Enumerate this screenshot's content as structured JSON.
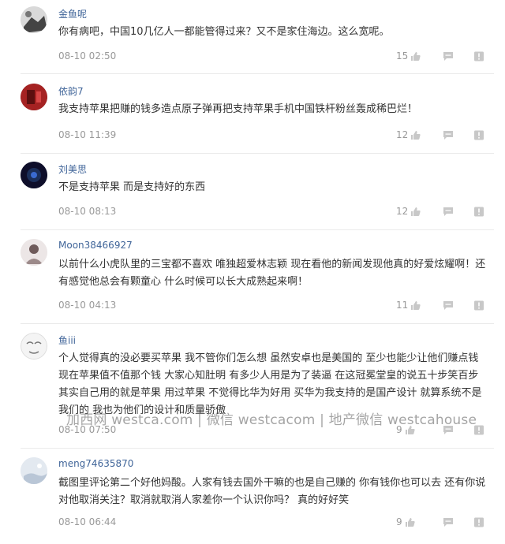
{
  "comments": [
    {
      "user": "金鱼呢",
      "text": "你有病吧，中国10几亿人一都能管得过来？又不是家住海边。这么宽呢。",
      "time": "08-10 02:50",
      "likes": "15"
    },
    {
      "user": "依韵7",
      "text": "我支持苹果把赚的钱多造点原子弹再把支持苹果手机中国铁杆粉丝轰成稀巴烂！",
      "time": "08-10 11:39",
      "likes": "12"
    },
    {
      "user": "刘美思",
      "text": "不是支持苹果 而是支持好的东西",
      "time": "08-10 08:13",
      "likes": "12"
    },
    {
      "user": "Moon38466927",
      "text": "以前什么小虎队里的三宝都不喜欢 唯独超爱林志颖 现在看他的新闻发现他真的好爱炫耀啊！还有感觉他总会有颗童心 什么时候可以长大成熟起来啊！",
      "time": "08-10 04:13",
      "likes": "11"
    },
    {
      "user": "鱼iii",
      "text": "个人觉得真的没必要买苹果 我不管你们怎么想 虽然安卓也是美国的 至少也能少让他们赚点钱 现在苹果值不值那个钱 大家心知肚明 有多少人用是为了装逼 在这冠冕堂皇的说五十步笑百步 其实自己用的就是苹果 用过苹果 不觉得比华为好用 买华为我支持的是国产设计 就算系统不是我们的 我也为他们的设计和质量骄傲",
      "time": "08-10 07:50",
      "likes": "9"
    },
    {
      "user": "meng74635870",
      "text": "截图里评论第二个好他妈酸。人家有钱去国外干嘛的也是自己赚的 你有钱你也可以去 还有你说对他取消关注？取消就取消人家差你一个认识你吗？ 真的好好笑",
      "time": "08-10 06:44",
      "likes": "9"
    }
  ],
  "watermark": "加西网 westca.com | 微信 westcacom | 地产微信 westcahouse"
}
